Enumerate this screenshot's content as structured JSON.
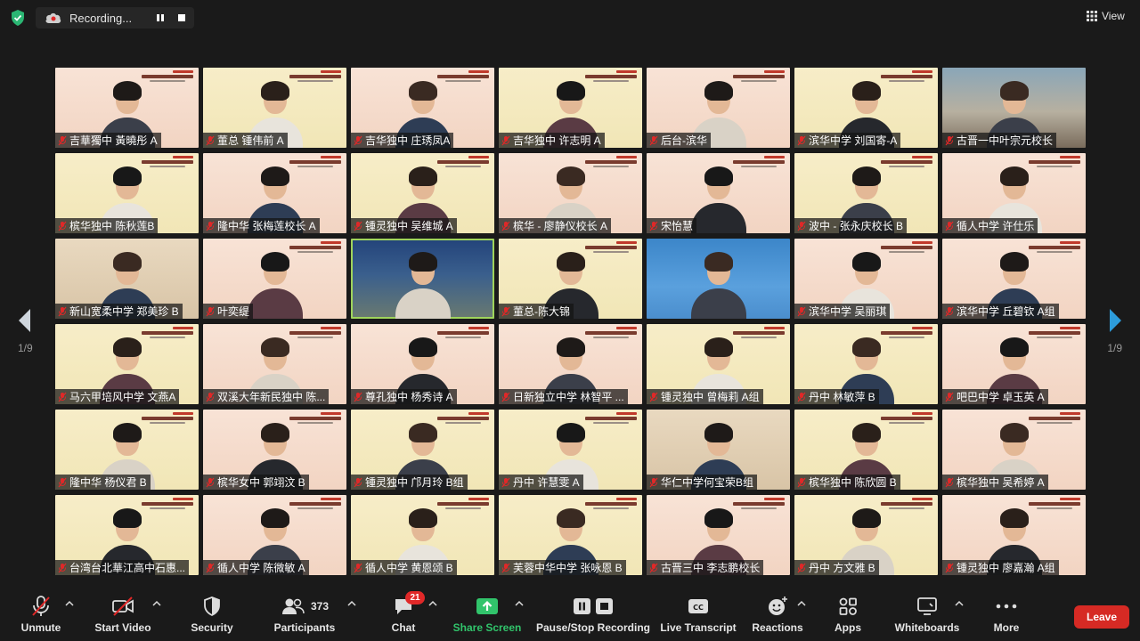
{
  "topbar": {
    "recording_label": "Recording...",
    "view_label": "View",
    "colors": {
      "shield": "#2bb673",
      "background": "#1a1a1a"
    }
  },
  "pagination": {
    "left_label": "1/9",
    "right_label": "1/9"
  },
  "participants_grid": {
    "name_bar_color": "rgba(20,20,20,0.72)",
    "muted_icon": "mic-off-icon",
    "tiles": [
      {
        "name": "吉華獨中 黃曉彤 A",
        "bg": "bg-p"
      },
      {
        "name": "董总 锺伟前 A",
        "bg": "bg-y"
      },
      {
        "name": "吉华独中 庄琇凤A",
        "bg": "bg-p"
      },
      {
        "name": "吉华独中 许志明 A",
        "bg": "bg-y"
      },
      {
        "name": "后台-滨华",
        "bg": "bg-p"
      },
      {
        "name": "滨华中学 刘国寄-A",
        "bg": "bg-y"
      },
      {
        "name": "古晋一中叶宗元校长",
        "bg": "bg-photo"
      },
      {
        "name": "槟华独中 陈秋莲B",
        "bg": "bg-y"
      },
      {
        "name": "隆中华 张梅莲校长 A",
        "bg": "bg-p"
      },
      {
        "name": "锺灵独中 吴维城 A",
        "bg": "bg-y"
      },
      {
        "name": "槟华 - 廖静仪校长 A",
        "bg": "bg-p"
      },
      {
        "name": "宋怡慧",
        "bg": "bg-p"
      },
      {
        "name": "波中 - 张永庆校长 B",
        "bg": "bg-y"
      },
      {
        "name": "循人中学 许仕乐",
        "bg": "bg-p"
      },
      {
        "name": "新山宽柔中学 郑美珍 B",
        "bg": "bg-room"
      },
      {
        "name": "叶奕缇",
        "bg": "bg-p"
      },
      {
        "name": "",
        "bg": "bg-night"
      },
      {
        "name": "董总-陈大锦",
        "bg": "bg-y"
      },
      {
        "name": "",
        "bg": "bg-blue"
      },
      {
        "name": "滨华中学 吴丽琪",
        "bg": "bg-p"
      },
      {
        "name": "滨华中学 丘碧钦 A组",
        "bg": "bg-p"
      },
      {
        "name": "马六甲培风中学 文燕A",
        "bg": "bg-y"
      },
      {
        "name": "双溪大年新民独中 陈...",
        "bg": "bg-p"
      },
      {
        "name": "尊孔独中 杨秀诗 A",
        "bg": "bg-p"
      },
      {
        "name": "日新独立中学 林智平 ...",
        "bg": "bg-p"
      },
      {
        "name": "锺灵独中 曾梅莉 A组",
        "bg": "bg-y"
      },
      {
        "name": "丹中 林敏萍 B",
        "bg": "bg-y"
      },
      {
        "name": "吧巴中学 卓玉英 A",
        "bg": "bg-p"
      },
      {
        "name": "隆中华 杨仪君 B",
        "bg": "bg-y"
      },
      {
        "name": "槟华女中 郭翊汶 B",
        "bg": "bg-p"
      },
      {
        "name": "锺灵独中 邝月玲 B组",
        "bg": "bg-y"
      },
      {
        "name": "丹中 许慧雯 A",
        "bg": "bg-y"
      },
      {
        "name": "华仁中学何宝荣B组",
        "bg": "bg-room"
      },
      {
        "name": "槟华独中 陈欣圆 B",
        "bg": "bg-y"
      },
      {
        "name": "槟华独中 吴希婷 A",
        "bg": "bg-p"
      },
      {
        "name": "台湾台北華江高中石惠...",
        "bg": "bg-y"
      },
      {
        "name": "循人中学 陈微敏 A",
        "bg": "bg-p"
      },
      {
        "name": "循人中学 黄恩颂 B",
        "bg": "bg-y"
      },
      {
        "name": "芙蓉中华中学 张咏恩 B",
        "bg": "bg-y"
      },
      {
        "name": "古晋三中 李志鹏校长",
        "bg": "bg-p"
      },
      {
        "name": "丹中 方文雅 B",
        "bg": "bg-y"
      },
      {
        "name": "锺灵独中 廖嘉瀚 A组",
        "bg": "bg-p"
      }
    ]
  },
  "toolbar": {
    "unmute": "Unmute",
    "start_video": "Start Video",
    "security": "Security",
    "participants": "Participants",
    "participants_count": "373",
    "chat": "Chat",
    "chat_badge": "21",
    "share_screen": "Share Screen",
    "pause_stop_recording": "Pause/Stop Recording",
    "live_transcript": "Live Transcript",
    "reactions": "Reactions",
    "apps": "Apps",
    "whiteboards": "Whiteboards",
    "more": "More",
    "leave": "Leave",
    "colors": {
      "share": "#31c46b",
      "leave": "#d62a24",
      "muted": "#e02828"
    }
  }
}
